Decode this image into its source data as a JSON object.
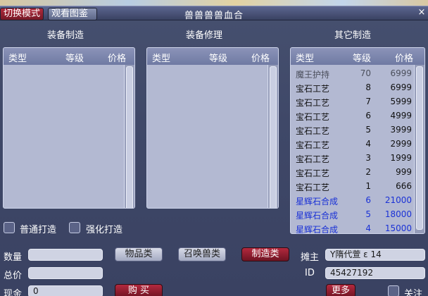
{
  "window": {
    "title": "兽兽兽兽血合",
    "mode_button": "切换模式",
    "atlas_button": "观看图鉴",
    "close": "×"
  },
  "sections": {
    "equip_make": "装备制造",
    "equip_repair": "装备修理",
    "other_make": "其它制造"
  },
  "columns": {
    "type": "类型",
    "level": "等级",
    "price": "价格"
  },
  "other_rows": [
    {
      "type": "魔王护持",
      "level": "70",
      "price": "6999",
      "style": "grey"
    },
    {
      "type": "宝石工艺",
      "level": "8",
      "price": "6999",
      "style": "black"
    },
    {
      "type": "宝石工艺",
      "level": "7",
      "price": "5999",
      "style": "black"
    },
    {
      "type": "宝石工艺",
      "level": "6",
      "price": "4999",
      "style": "black"
    },
    {
      "type": "宝石工艺",
      "level": "5",
      "price": "3999",
      "style": "black"
    },
    {
      "type": "宝石工艺",
      "level": "4",
      "price": "2999",
      "style": "black"
    },
    {
      "type": "宝石工艺",
      "level": "3",
      "price": "1999",
      "style": "black"
    },
    {
      "type": "宝石工艺",
      "level": "2",
      "price": "999",
      "style": "black"
    },
    {
      "type": "宝石工艺",
      "level": "1",
      "price": "666",
      "style": "black"
    },
    {
      "type": "星辉石合成",
      "level": "6",
      "price": "21000",
      "style": "blue"
    },
    {
      "type": "星辉石合成",
      "level": "5",
      "price": "18000",
      "style": "blue"
    },
    {
      "type": "星辉石合成",
      "level": "4",
      "price": "15000",
      "style": "blue"
    }
  ],
  "options": {
    "normal_forge": "普通打造",
    "strong_forge": "强化打造"
  },
  "form": {
    "quantity_label": "数量",
    "quantity_value": "",
    "total_label": "总价",
    "total_value": "",
    "cash_label": "现金",
    "cash_value": "0",
    "owner_label": "摊主",
    "owner_value": "Y隋代萱 ε 14",
    "id_label": "ID",
    "id_value": "45427192"
  },
  "buttons": {
    "items": "物品类",
    "summon": "召唤兽类",
    "make": "制造类",
    "buy": "购 买",
    "more": "更多",
    "follow": "关注"
  },
  "colors": {
    "window_bg": "#3f4767",
    "list_bg": "#b3b9d2",
    "header_bg": "#7b85ad",
    "accent_red": "#9a2033",
    "text_blue": "#1a31d6"
  }
}
